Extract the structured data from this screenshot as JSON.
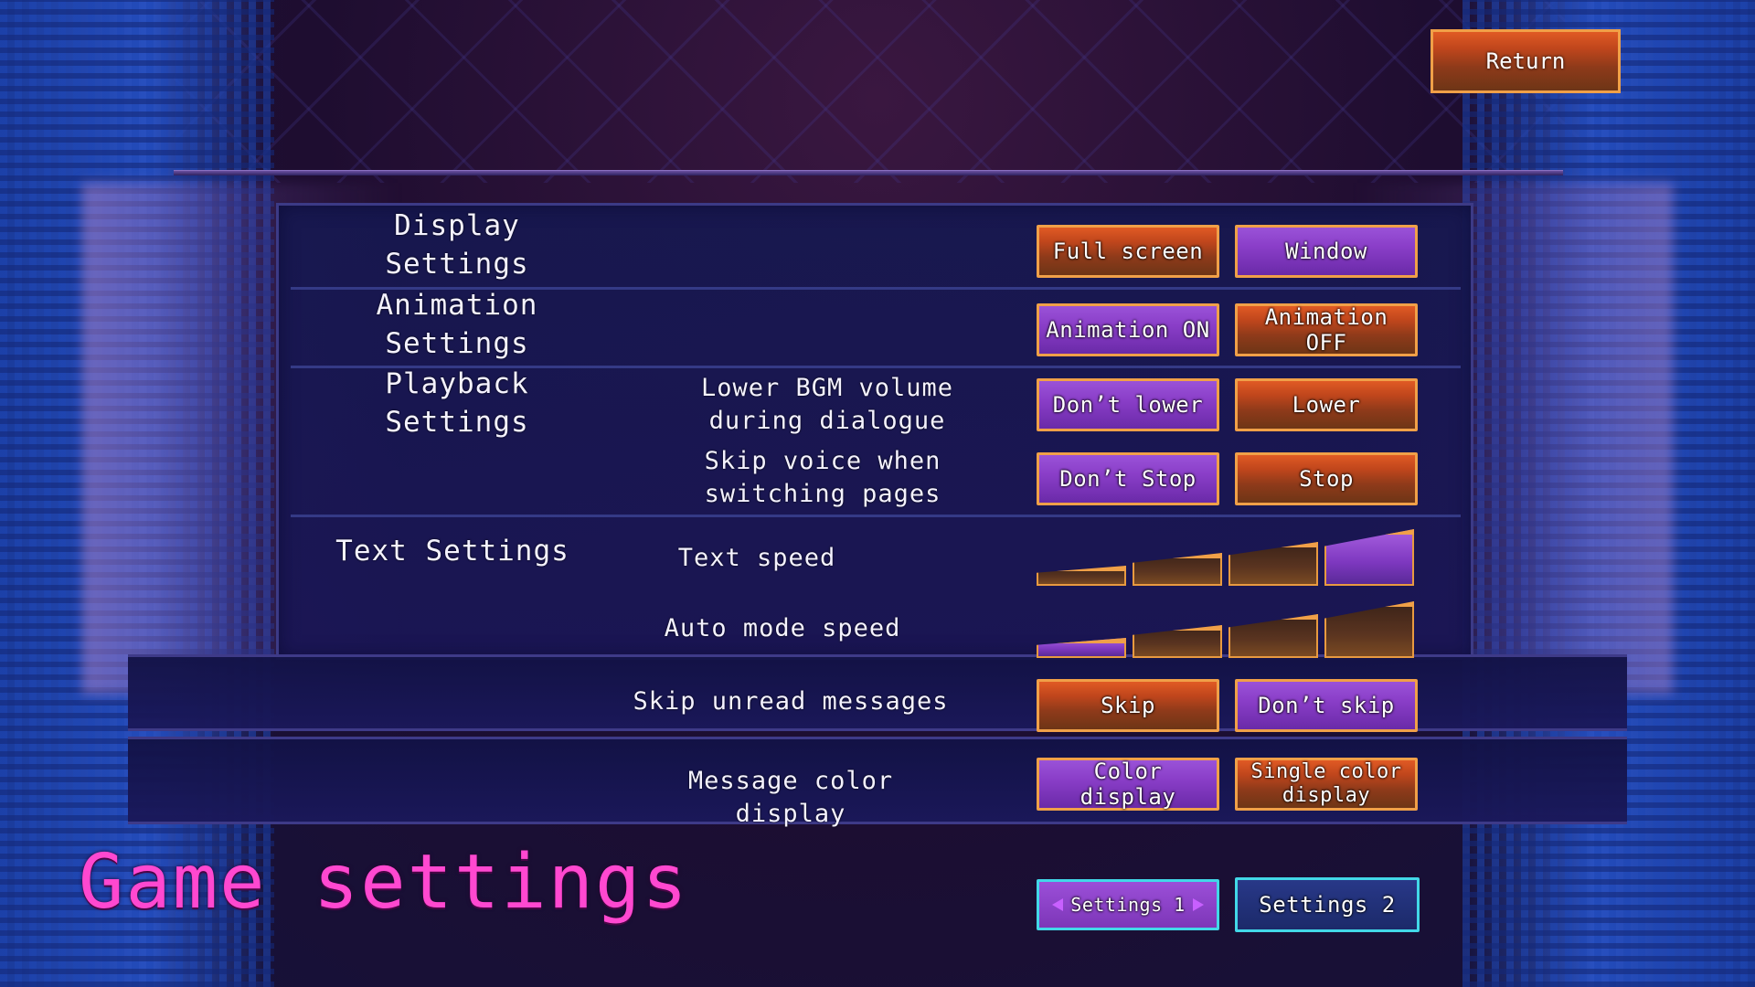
{
  "header": {
    "return_label": "Return"
  },
  "sections": {
    "display": {
      "label": "Display\nSettings",
      "full_screen": "Full screen",
      "window": "Window"
    },
    "animation": {
      "label": "Animation\nSettings",
      "on": "Animation ON",
      "off": "Animation OFF"
    },
    "playback": {
      "label": "Playback\nSettings",
      "bgm_label": "Lower BGM volume\nduring dialogue",
      "bgm_dont": "Don’t lower",
      "bgm_lower": "Lower",
      "voice_label": "Skip voice when\nswitching pages",
      "voice_dont": "Don’t Stop",
      "voice_stop": "Stop"
    },
    "text": {
      "label": "Text Settings",
      "text_speed_label": "Text speed",
      "text_speed_level": 4,
      "auto_speed_label": "Auto mode speed",
      "auto_speed_level": 1
    },
    "skip_unread": {
      "label": "Skip unread messages",
      "skip": "Skip",
      "dont_skip": "Don’t skip"
    },
    "message_color": {
      "label": "Message color display",
      "color": "Color display",
      "single": "Single color\ndisplay"
    }
  },
  "footer": {
    "title": "Game settings",
    "page1": "Settings 1",
    "page2": "Settings 2"
  },
  "colors": {
    "title": "#ff48d0",
    "button_orange": "#c0461c",
    "button_purple": "#8a3ec8",
    "button_border": "#f0a048",
    "page_tab_border": "#42d8e8"
  }
}
